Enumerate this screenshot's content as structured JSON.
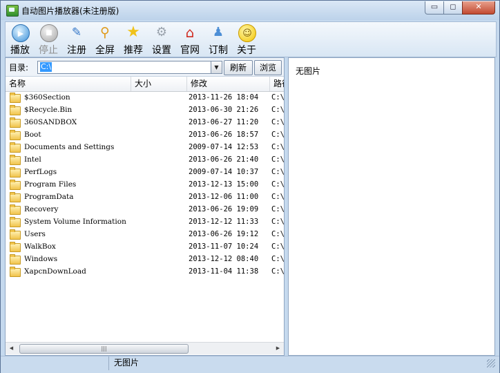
{
  "window": {
    "title": "自动图片播放器(未注册版)",
    "controls": {
      "minimize": "▭",
      "maximize": "◻",
      "close": "✕"
    }
  },
  "toolbar": {
    "buttons": [
      {
        "label": "播放",
        "icon": "play-icon",
        "enabled": true
      },
      {
        "label": "停止",
        "icon": "stop-icon",
        "enabled": false
      },
      {
        "label": "注册",
        "icon": "register-icon",
        "enabled": true
      },
      {
        "label": "全屏",
        "icon": "fullscreen-icon",
        "enabled": true
      },
      {
        "label": "推荐",
        "icon": "star-icon",
        "enabled": true
      },
      {
        "label": "设置",
        "icon": "settings-icon",
        "enabled": true
      },
      {
        "label": "官网",
        "icon": "home-icon",
        "enabled": true
      },
      {
        "label": "订制",
        "icon": "users-icon",
        "enabled": true
      },
      {
        "label": "关于",
        "icon": "smiley-icon",
        "enabled": true
      }
    ]
  },
  "path_bar": {
    "label": "目录:",
    "value": "C:\\",
    "refresh_label": "刷新",
    "browse_label": "浏览"
  },
  "file_list": {
    "columns": [
      "名称",
      "大小",
      "修改",
      "路径"
    ],
    "rows": [
      {
        "name": "$360Section",
        "size": "",
        "modified": "2013-11-26 18:04",
        "path": "C:\\"
      },
      {
        "name": "$Recycle.Bin",
        "size": "",
        "modified": "2013-06-30 21:26",
        "path": "C:\\"
      },
      {
        "name": "360SANDBOX",
        "size": "",
        "modified": "2013-06-27 11:20",
        "path": "C:\\"
      },
      {
        "name": "Boot",
        "size": "",
        "modified": "2013-06-26 18:57",
        "path": "C:\\"
      },
      {
        "name": "Documents and Settings",
        "size": "",
        "modified": "2009-07-14 12:53",
        "path": "C:\\"
      },
      {
        "name": "Intel",
        "size": "",
        "modified": "2013-06-26 21:40",
        "path": "C:\\"
      },
      {
        "name": "PerfLogs",
        "size": "",
        "modified": "2009-07-14 10:37",
        "path": "C:\\"
      },
      {
        "name": "Program Files",
        "size": "",
        "modified": "2013-12-13 15:00",
        "path": "C:\\"
      },
      {
        "name": "ProgramData",
        "size": "",
        "modified": "2013-12-06 11:00",
        "path": "C:\\"
      },
      {
        "name": "Recovery",
        "size": "",
        "modified": "2013-06-26 19:09",
        "path": "C:\\"
      },
      {
        "name": "System Volume Information",
        "size": "",
        "modified": "2013-12-12 11:33",
        "path": "C:\\"
      },
      {
        "name": "Users",
        "size": "",
        "modified": "2013-06-26 19:12",
        "path": "C:\\"
      },
      {
        "name": "WalkBox",
        "size": "",
        "modified": "2013-11-07 10:24",
        "path": "C:\\"
      },
      {
        "name": "Windows",
        "size": "",
        "modified": "2013-12-12 08:40",
        "path": "C:\\"
      },
      {
        "name": "XapcnDownLoad",
        "size": "",
        "modified": "2013-11-04 11:38",
        "path": "C:\\"
      }
    ]
  },
  "preview": {
    "text": "无图片"
  },
  "status_bar": {
    "text": "无图片"
  }
}
